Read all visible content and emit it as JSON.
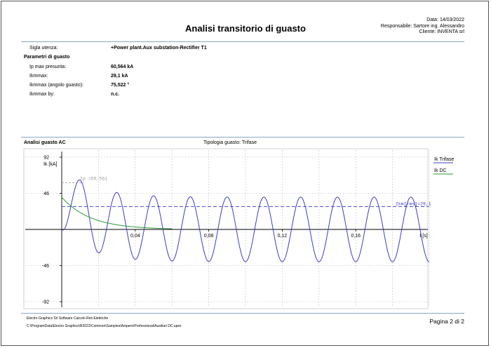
{
  "header": {
    "title": "Analisi transitorio di guasto",
    "date": "Data: 14/03/2022",
    "responsible": "Responsabile: Sartore ing. Alessandro",
    "client": "Cliente: INVENTA srl"
  },
  "details": {
    "sigla_label": "Sigla utenza:",
    "sigla_value": "+Power plant.Aux substation-Rectifier T1",
    "params_title": "Parametri di guasto",
    "rows": [
      {
        "label": "Ip max presunta:",
        "value": "60,564 kA"
      },
      {
        "label": "Ikmmax:",
        "value": "29,1 kA"
      },
      {
        "label": "Ikmmax (angolo guasto):",
        "value": "75,522 °"
      },
      {
        "label": "Ikmmax by:",
        "value": "n.c."
      }
    ]
  },
  "chart_section": {
    "title": "Analisi guasto AC",
    "subtitle": "Tipologia guasto: Trifase"
  },
  "chart_data": {
    "type": "line",
    "ylabel": "Ik [kA]",
    "xlabel": "t [s]",
    "xlim": [
      0,
      0.2
    ],
    "ylim": [
      -92,
      92
    ],
    "yticks": [
      92,
      46,
      -46,
      -92
    ],
    "xticks": [
      0.04,
      0.08,
      0.12,
      0.16
    ],
    "ytick_labels": [
      "92",
      "46",
      "-46",
      "-92"
    ],
    "xtick_labels": [
      "0,04",
      "0,08",
      "0,12",
      "0,16"
    ],
    "grid": true,
    "legend_position": "right",
    "series": [
      {
        "name": "Ik Trifase",
        "color": "#3c3cc8",
        "amplitude": 41.15,
        "frequency_hz": 50,
        "dc_initial": 41.15,
        "tau_s": 0.0155
      },
      {
        "name": "Ik DC",
        "color": "#2e9a2e",
        "initial": 41.15,
        "tau_s": 0.0155,
        "end_t": 0.06
      }
    ],
    "annotations": [
      {
        "text": "Ip =59,561",
        "value": 59.561,
        "t_end": 0.012
      },
      {
        "text": "Ikm[rms]=29,1",
        "value": 29.1
      }
    ]
  },
  "footer": {
    "company": "Electro Graphics Srl  Software Calcolo Reti Elettriche",
    "path": "C:\\ProgramData\\Electro Graphics\\R2022\\Common\\Samples\\Ampere\\Professional\\Ausiliari DC.upex",
    "page": "Pagina 2 di 2"
  }
}
